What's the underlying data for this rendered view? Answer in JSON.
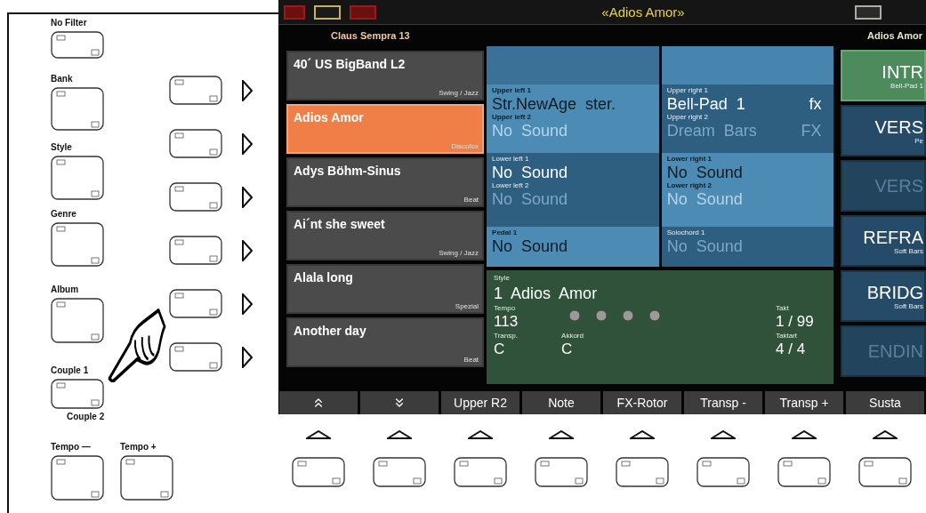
{
  "panel": {
    "filters": [
      {
        "label": "No Filter"
      },
      {
        "label": "Bank"
      },
      {
        "label": "Style"
      },
      {
        "label": "Genre"
      },
      {
        "label": "Album"
      },
      {
        "label": "Couple 1",
        "sublabel": "Couple 2"
      }
    ],
    "tempo": [
      {
        "label": "Tempo —"
      },
      {
        "label": "Tempo +"
      }
    ]
  },
  "display": {
    "title": "«Adios Amor»",
    "bank": "Claus Sempra 13",
    "current_song": "Adios Amor",
    "songs": [
      {
        "title": "40´ US BigBand L2",
        "genre": "Swing / Jazz",
        "selected": false
      },
      {
        "title": "Adios Amor",
        "genre": "Discofox",
        "selected": true
      },
      {
        "title": "Adys Böhm-Sinus",
        "genre": "Beat",
        "selected": false
      },
      {
        "title": "Ai´nt she sweet",
        "genre": "Swing / Jazz",
        "selected": false
      },
      {
        "title": "Alala long",
        "genre": "Spezial",
        "selected": false
      },
      {
        "title": "Another day",
        "genre": "Beat",
        "selected": false
      }
    ],
    "voice_columns": [
      {
        "groups": [
          {
            "highlighted": true,
            "cells": [
              {
                "label": "Upper left 1",
                "name": "Str.NewAge  ster.",
                "active": true
              },
              {
                "label": "Upper left 2",
                "name": "No  Sound",
                "active": false
              }
            ]
          },
          {
            "highlighted": false,
            "cells": [
              {
                "label": "Lower left 1",
                "name": "No  Sound",
                "active": true
              },
              {
                "label": "Lower left 2",
                "name": "No  Sound",
                "active": false
              }
            ]
          },
          {
            "highlighted": true,
            "cells": [
              {
                "label": "Pedal 1",
                "name": "No  Sound",
                "active": true
              }
            ]
          }
        ]
      },
      {
        "groups": [
          {
            "highlighted": false,
            "cells": [
              {
                "label": "Upper right 1",
                "name": "Bell-Pad  1",
                "fx": "fx",
                "active": true
              },
              {
                "label": "Upper right 2",
                "name": "Dream  Bars",
                "fx": "FX",
                "active": false
              }
            ]
          },
          {
            "highlighted": true,
            "cells": [
              {
                "label": "Lower right 1",
                "name": "No  Sound",
                "active": true
              },
              {
                "label": "Lower right 2",
                "name": "No  Sound",
                "active": false
              }
            ]
          },
          {
            "highlighted": false,
            "cells": [
              {
                "label": "Solochord 1",
                "name": "No  Sound",
                "active": false
              }
            ]
          }
        ]
      }
    ],
    "style": {
      "label": "Style",
      "name": "1  Adios  Amor",
      "fields": [
        {
          "label": "Tempo",
          "value": "113"
        },
        {
          "label": "Takt",
          "value": "1 / 99"
        },
        {
          "label": "Transp.",
          "value": "C"
        },
        {
          "label": "Akkord",
          "value": "C"
        },
        {
          "label": "Taktart",
          "value": "4 / 4"
        }
      ]
    },
    "sections": [
      {
        "label": "INTR",
        "sublabel": "Bell-Pad 1",
        "selected": true,
        "disabled": false
      },
      {
        "label": "VERS",
        "sublabel": "Pe",
        "selected": false,
        "disabled": false
      },
      {
        "label": "VERS",
        "selected": false,
        "disabled": true
      },
      {
        "label": "REFRA",
        "sublabel": "Soft Bars",
        "selected": false,
        "disabled": false
      },
      {
        "label": "BRIDG",
        "sublabel": "Soft Bars",
        "selected": false,
        "disabled": false
      },
      {
        "label": "ENDIN",
        "selected": false,
        "disabled": true
      }
    ],
    "softkeys": [
      {
        "kind": "page-up"
      },
      {
        "kind": "page-down"
      },
      {
        "kind": "text",
        "label": "Upper R2"
      },
      {
        "kind": "text",
        "label": "Note"
      },
      {
        "kind": "text",
        "label": "FX-Rotor"
      },
      {
        "kind": "text",
        "label": "Transp -"
      },
      {
        "kind": "text",
        "label": "Transp +"
      },
      {
        "kind": "text",
        "label": "Susta"
      }
    ]
  }
}
